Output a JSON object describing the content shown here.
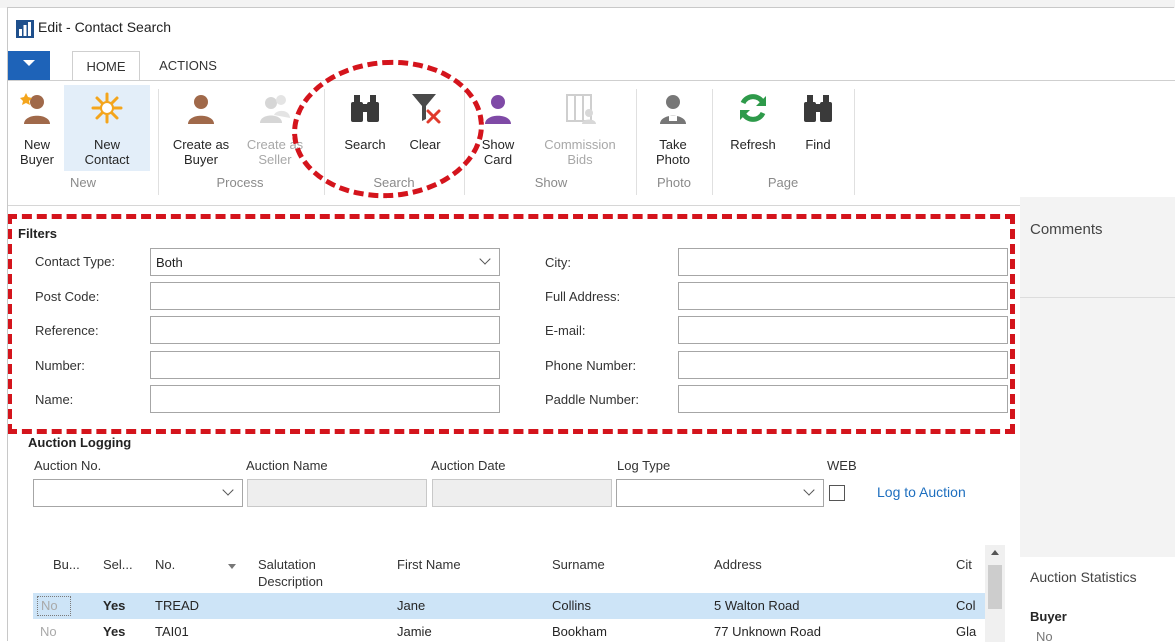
{
  "window": {
    "title": "Edit - Contact Search"
  },
  "tabs": [
    {
      "label": "HOME"
    },
    {
      "label": "ACTIONS"
    }
  ],
  "ribbon": {
    "buttons": {
      "new_buyer": "New\nBuyer",
      "new_contact": "New\nContact",
      "create_buyer": "Create as\nBuyer",
      "create_seller": "Create as\nSeller",
      "search": "Search",
      "clear": "Clear",
      "show_card": "Show\nCard",
      "commission_bids": "Commission\nBids",
      "take_photo": "Take\nPhoto",
      "refresh": "Refresh",
      "find": "Find"
    },
    "groups": {
      "new": "New",
      "process": "Process",
      "search": "Search",
      "show": "Show",
      "photo": "Photo",
      "page": "Page"
    }
  },
  "filters": {
    "section": "Filters",
    "contact_type": {
      "label": "Contact Type:",
      "value": "Both"
    },
    "post_code": {
      "label": "Post Code:",
      "value": ""
    },
    "reference": {
      "label": "Reference:",
      "value": ""
    },
    "number": {
      "label": "Number:",
      "value": ""
    },
    "name": {
      "label": "Name:",
      "value": ""
    },
    "city": {
      "label": "City:",
      "value": ""
    },
    "full_address": {
      "label": "Full Address:",
      "value": ""
    },
    "email": {
      "label": "E-mail:",
      "value": ""
    },
    "phone": {
      "label": "Phone Number:",
      "value": ""
    },
    "paddle": {
      "label": "Paddle Number:",
      "value": ""
    }
  },
  "auction_logging": {
    "section": "Auction Logging",
    "auction_no": "Auction No.",
    "auction_name": "Auction Name",
    "auction_date": "Auction Date",
    "log_type": "Log Type",
    "web": "WEB",
    "log_link": "Log to Auction"
  },
  "grid": {
    "headers": [
      "Bu...",
      "Sel...",
      "No.",
      "Salutation\nDescription",
      "First Name",
      "Surname",
      "Address",
      "Cit"
    ],
    "rows": [
      [
        "No",
        "Yes",
        "TREAD",
        "",
        "Jane",
        "Collins",
        "5 Walton Road",
        "Col"
      ],
      [
        "No",
        "Yes",
        "TAI01",
        "",
        "Jamie",
        "Bookham",
        "77 Unknown Road",
        "Gla"
      ]
    ]
  },
  "right_panel": {
    "comments": "Comments",
    "auction_statistics": "Auction Statistics",
    "buyer": "Buyer",
    "buyer_value": "No"
  },
  "colors": {
    "accent": "#1e63b8",
    "annotation": "#d4141c",
    "selected_row": "#cde4f7",
    "link": "#1e6fbf"
  }
}
